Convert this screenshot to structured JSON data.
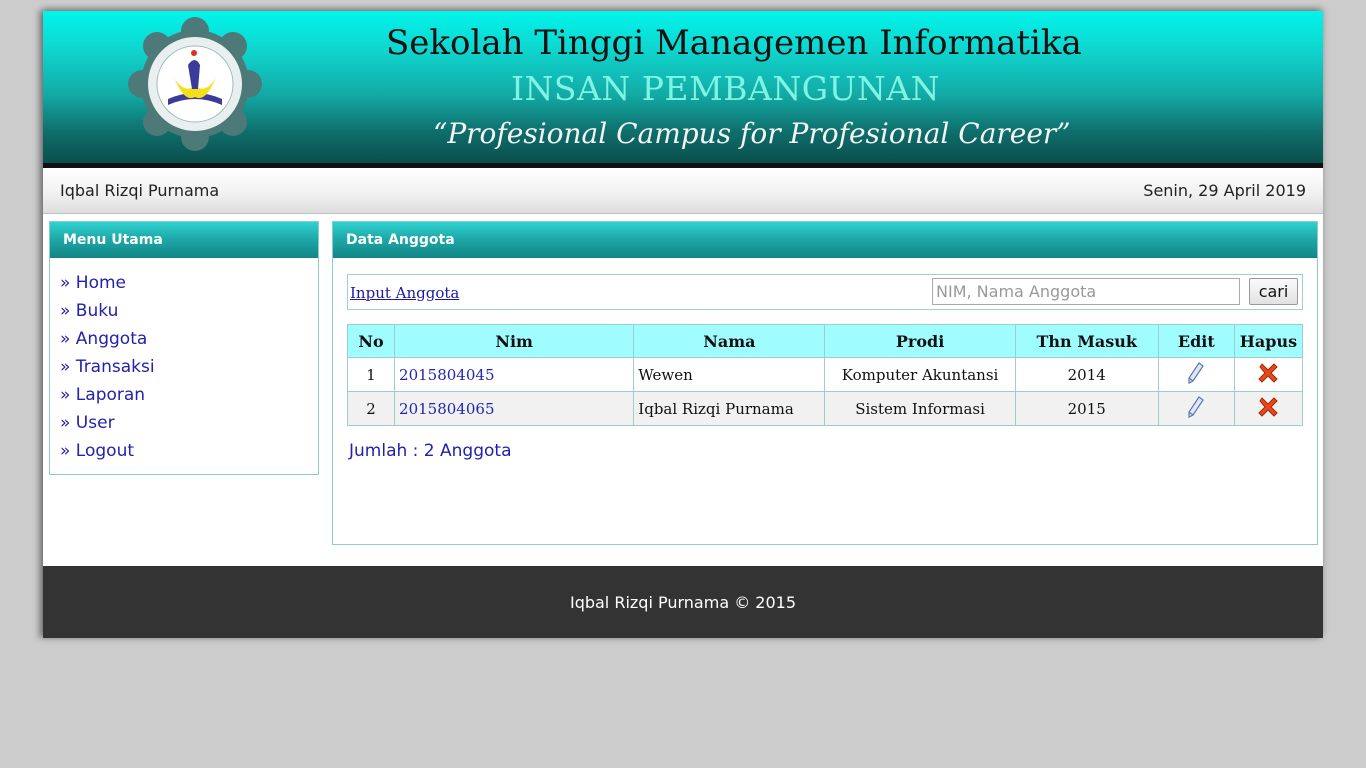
{
  "header": {
    "title": "Sekolah Tinggi Managemen Informatika",
    "subtitle": "INSAN PEMBANGUNAN",
    "slogan": "“Profesional Campus for Profesional Career”"
  },
  "userbar": {
    "user_name": "Iqbal Rizqi Purnama",
    "date": "Senin, 29 April 2019"
  },
  "sidebar": {
    "title": "Menu Utama",
    "items": [
      {
        "label": "» Home"
      },
      {
        "label": "» Buku"
      },
      {
        "label": "» Anggota"
      },
      {
        "label": "» Transaksi"
      },
      {
        "label": "» Laporan"
      },
      {
        "label": "» User"
      },
      {
        "label": "» Logout"
      }
    ]
  },
  "main": {
    "title": "Data Anggota",
    "input_link": "Input Anggota",
    "search": {
      "placeholder": "NIM, Nama Anggota",
      "value": ""
    },
    "search_button": "cari",
    "table": {
      "headers": [
        "No",
        "Nim",
        "Nama",
        "Prodi",
        "Thn Masuk",
        "Edit",
        "Hapus"
      ],
      "rows": [
        {
          "no": "1",
          "nim": "2015804045",
          "nama": "Wewen",
          "prodi": "Komputer Akuntansi",
          "thn": "2014"
        },
        {
          "no": "2",
          "nim": "2015804065",
          "nama": "Iqbal Rizqi Purnama",
          "prodi": "Sistem Informasi",
          "thn": "2015"
        }
      ]
    },
    "total": "Jumlah : 2 Anggota"
  },
  "footer": {
    "text": "Iqbal Rizqi Purnama © 2015"
  },
  "colors": {
    "accent_teal": "#1fa9a9",
    "table_header": "#9ffcff",
    "link_blue": "#2222aa",
    "footer_bg": "#333333"
  },
  "icons": {
    "edit": "pencil-icon",
    "delete": "red-x-icon",
    "logo": "campus-seal-logo"
  }
}
